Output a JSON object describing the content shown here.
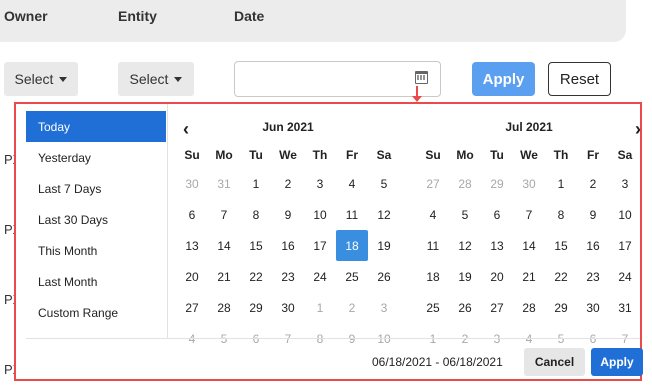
{
  "columns": {
    "owner": "Owner",
    "entity": "Entity",
    "date": "Date"
  },
  "filters": {
    "owner_select": "Select",
    "entity_select": "Select",
    "date_value": ""
  },
  "actions": {
    "apply": "Apply",
    "reset": "Reset"
  },
  "row_fragments": [
    "PX",
    "PX",
    "PX",
    "PX"
  ],
  "ranges": [
    {
      "label": "Today",
      "active": true
    },
    {
      "label": "Yesterday",
      "active": false
    },
    {
      "label": "Last 7 Days",
      "active": false
    },
    {
      "label": "Last 30 Days",
      "active": false
    },
    {
      "label": "This Month",
      "active": false
    },
    {
      "label": "Last Month",
      "active": false
    },
    {
      "label": "Custom Range",
      "active": false
    }
  ],
  "weekdays": [
    "Su",
    "Mo",
    "Tu",
    "We",
    "Th",
    "Fr",
    "Sa"
  ],
  "calendars": [
    {
      "month": "Jun 2021",
      "days": [
        [
          "30",
          "off"
        ],
        [
          "31",
          "off"
        ],
        [
          "1",
          ""
        ],
        [
          "2",
          ""
        ],
        [
          "3",
          ""
        ],
        [
          "4",
          ""
        ],
        [
          "5",
          ""
        ],
        [
          "6",
          ""
        ],
        [
          "7",
          ""
        ],
        [
          "8",
          ""
        ],
        [
          "9",
          ""
        ],
        [
          "10",
          ""
        ],
        [
          "11",
          ""
        ],
        [
          "12",
          ""
        ],
        [
          "13",
          ""
        ],
        [
          "14",
          ""
        ],
        [
          "15",
          ""
        ],
        [
          "16",
          ""
        ],
        [
          "17",
          ""
        ],
        [
          "18",
          "sel"
        ],
        [
          "19",
          ""
        ],
        [
          "20",
          ""
        ],
        [
          "21",
          ""
        ],
        [
          "22",
          ""
        ],
        [
          "23",
          ""
        ],
        [
          "24",
          ""
        ],
        [
          "25",
          ""
        ],
        [
          "26",
          ""
        ],
        [
          "27",
          ""
        ],
        [
          "28",
          ""
        ],
        [
          "29",
          ""
        ],
        [
          "30",
          ""
        ],
        [
          "1",
          "off"
        ],
        [
          "2",
          "off"
        ],
        [
          "3",
          "off"
        ],
        [
          "4",
          "off"
        ],
        [
          "5",
          "off"
        ],
        [
          "6",
          "off"
        ],
        [
          "7",
          "off"
        ],
        [
          "8",
          "off"
        ],
        [
          "9",
          "off"
        ],
        [
          "10",
          "off"
        ]
      ]
    },
    {
      "month": "Jul 2021",
      "days": [
        [
          "27",
          "off"
        ],
        [
          "28",
          "off"
        ],
        [
          "29",
          "off"
        ],
        [
          "30",
          "off"
        ],
        [
          "1",
          ""
        ],
        [
          "2",
          ""
        ],
        [
          "3",
          ""
        ],
        [
          "4",
          ""
        ],
        [
          "5",
          ""
        ],
        [
          "6",
          ""
        ],
        [
          "7",
          ""
        ],
        [
          "8",
          ""
        ],
        [
          "9",
          ""
        ],
        [
          "10",
          ""
        ],
        [
          "11",
          ""
        ],
        [
          "12",
          ""
        ],
        [
          "13",
          ""
        ],
        [
          "14",
          ""
        ],
        [
          "15",
          ""
        ],
        [
          "16",
          ""
        ],
        [
          "17",
          ""
        ],
        [
          "18",
          ""
        ],
        [
          "19",
          ""
        ],
        [
          "20",
          ""
        ],
        [
          "21",
          ""
        ],
        [
          "22",
          ""
        ],
        [
          "23",
          ""
        ],
        [
          "24",
          ""
        ],
        [
          "25",
          ""
        ],
        [
          "26",
          ""
        ],
        [
          "27",
          ""
        ],
        [
          "28",
          ""
        ],
        [
          "29",
          ""
        ],
        [
          "30",
          ""
        ],
        [
          "31",
          ""
        ],
        [
          "1",
          "off"
        ],
        [
          "2",
          "off"
        ],
        [
          "3",
          "off"
        ],
        [
          "4",
          "off"
        ],
        [
          "5",
          "off"
        ],
        [
          "6",
          "off"
        ],
        [
          "7",
          "off"
        ]
      ]
    }
  ],
  "picker_footer": {
    "range_text": "06/18/2021 - 06/18/2021",
    "cancel": "Cancel",
    "apply": "Apply"
  },
  "colors": {
    "highlight": "#ec4a4a",
    "primary": "#1f6fd6",
    "selected_day": "#3a8ee0",
    "apply_top": "#5a9ff0"
  }
}
